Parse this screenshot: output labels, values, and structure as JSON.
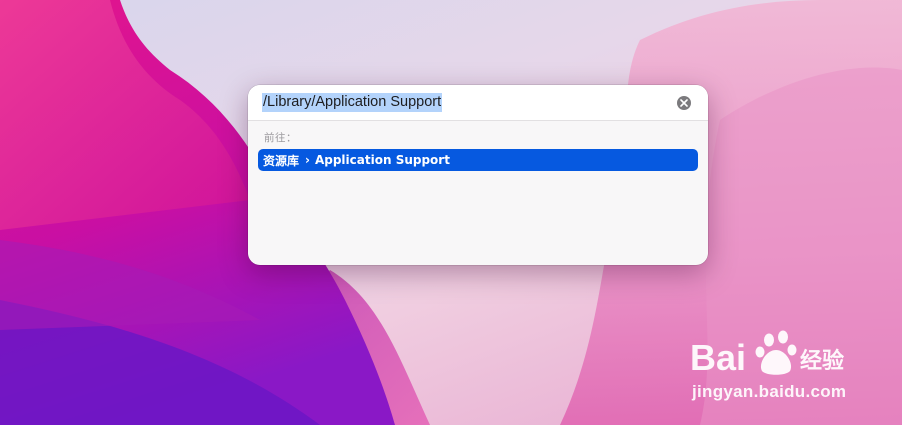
{
  "go_to_folder": {
    "path_value": "/Library/Application Support",
    "clear_icon": "x-circle-fill-icon",
    "section_label": "前往：",
    "result": {
      "crumbs": [
        "资源库",
        "Application Support"
      ],
      "separator": "›"
    }
  },
  "watermark": {
    "brand_text": "Bai",
    "brand_text_2": "经验",
    "domain": "jingyan.baidu.com",
    "logo_icon": "baidu-paw-icon"
  },
  "colors": {
    "selection_highlight": "#b3d3fb",
    "result_selected_bg": "#0659e0",
    "wallpaper_magenta": "#d6128f",
    "wallpaper_purple": "#7a1cc7"
  }
}
